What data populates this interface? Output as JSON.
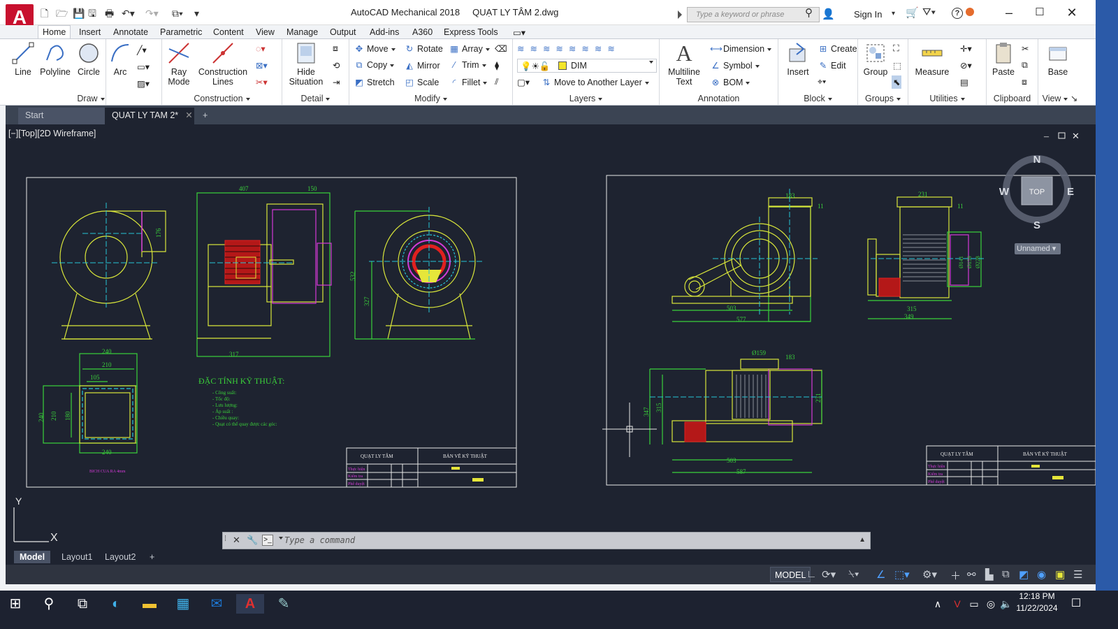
{
  "app": {
    "title": "AutoCAD Mechanical 2018",
    "filename": "QUẠT LY TÂM 2.dwg",
    "logo_letter": "A",
    "logo_sub": "M"
  },
  "titlebar": {
    "search_placeholder": "Type a keyword or phrase",
    "signin": "Sign In"
  },
  "ribbon_tabs": [
    "Home",
    "Insert",
    "Annotate",
    "Parametric",
    "Content",
    "View",
    "Manage",
    "Output",
    "Add-ins",
    "A360",
    "Express Tools"
  ],
  "ribbon": {
    "draw": {
      "label": "Draw",
      "line": "Line",
      "polyline": "Polyline",
      "circle": "Circle",
      "arc": "Arc"
    },
    "construction": {
      "label": "Construction",
      "ray": "Ray",
      "ray2": "Mode",
      "lines": "Construction",
      "lines2": "Lines"
    },
    "detail": {
      "label": "Detail",
      "hide": "Hide",
      "hide2": "Situation"
    },
    "modify": {
      "label": "Modify",
      "move": "Move",
      "rotate": "Rotate",
      "array": "Array",
      "copy": "Copy",
      "mirror": "Mirror",
      "trim": "Trim",
      "stretch": "Stretch",
      "scale": "Scale",
      "fillet": "Fillet"
    },
    "layers": {
      "label": "Layers",
      "current_layer": "DIM",
      "move_layer": "Move to Another Layer"
    },
    "annotation": {
      "label": "Annotation",
      "mtext": "Multiline",
      "mtext2": "Text",
      "dimension": "Dimension",
      "symbol": "Symbol",
      "bom": "BOM"
    },
    "block": {
      "label": "Block",
      "insert": "Insert",
      "create": "Create",
      "edit": "Edit"
    },
    "groups": {
      "label": "Groups",
      "group": "Group"
    },
    "utilities": {
      "label": "Utilities",
      "measure": "Measure"
    },
    "clipboard": {
      "label": "Clipboard",
      "paste": "Paste"
    },
    "view": {
      "label": "View",
      "base": "Base"
    }
  },
  "doc_tabs": {
    "start": "Start",
    "file": "QUAT LY TAM 2*"
  },
  "viewport_label": "[−][Top][2D Wireframe]",
  "viewcube": {
    "n": "N",
    "s": "S",
    "e": "E",
    "w": "W",
    "face": "TOP",
    "ucs": "Unnamed"
  },
  "command": {
    "placeholder": "Type a command"
  },
  "layout_tabs": [
    "Model",
    "Layout1",
    "Layout2"
  ],
  "statusbar": {
    "model": "MODEL"
  },
  "clock": {
    "time": "12:18 PM",
    "date": "11/22/2024"
  },
  "drawing": {
    "left_dims": {
      "d407": "407",
      "d150": "150",
      "d176": "176",
      "d532": "532",
      "d327": "327",
      "d317": "317",
      "d240": "240",
      "d210": "210",
      "d105": "105",
      "d240b": "240",
      "d210b": "210",
      "d180": "180",
      "d240c": "240"
    },
    "flange_caption": "BICH CUA RA 4mm",
    "tech_title": "ĐẶC TÍNH KỸ THUẬT:",
    "tech_lines": [
      "- Công suất:",
      "- Tốc độ:",
      "- Lưu lượng:",
      "- Áp suất :",
      "- Chiều quay:",
      "- Quạt có thể quay được các góc:"
    ],
    "titleblock_left": {
      "name": "QUẠT LY TÂM",
      "type": "BẢN VẼ KỸ THUẬT",
      "r1": "Thực hiện",
      "r2": "Kiểm tra",
      "r3": "Phê duyệt"
    },
    "right_dims": {
      "d183": "183",
      "d11": "11",
      "d503": "503",
      "d577": "577",
      "d231": "231",
      "d11b": "11",
      "d315": "315",
      "d349": "349",
      "d141": "Ø141",
      "d159": "Ø159",
      "d228": "Ø228",
      "d159b": "Ø159",
      "d183b": "183",
      "d347": "347",
      "d315b": "315",
      "d231b": "231",
      "d503b": "503",
      "d587": "587"
    },
    "titleblock_right": {
      "name": "QUẠT LY TÂM",
      "type": "BẢN VẼ KỸ THUẬT",
      "r1": "Thực hiện",
      "r2": "Kiểm tra",
      "r3": "Phê duyệt"
    }
  },
  "colors": {
    "canvas": "#1e2330",
    "yellow": "#e6e63a",
    "green": "#3ad13a",
    "cyan": "#27c4d6",
    "magenta": "#d43ad8",
    "red": "#e02020",
    "white": "#e8e8e8"
  }
}
